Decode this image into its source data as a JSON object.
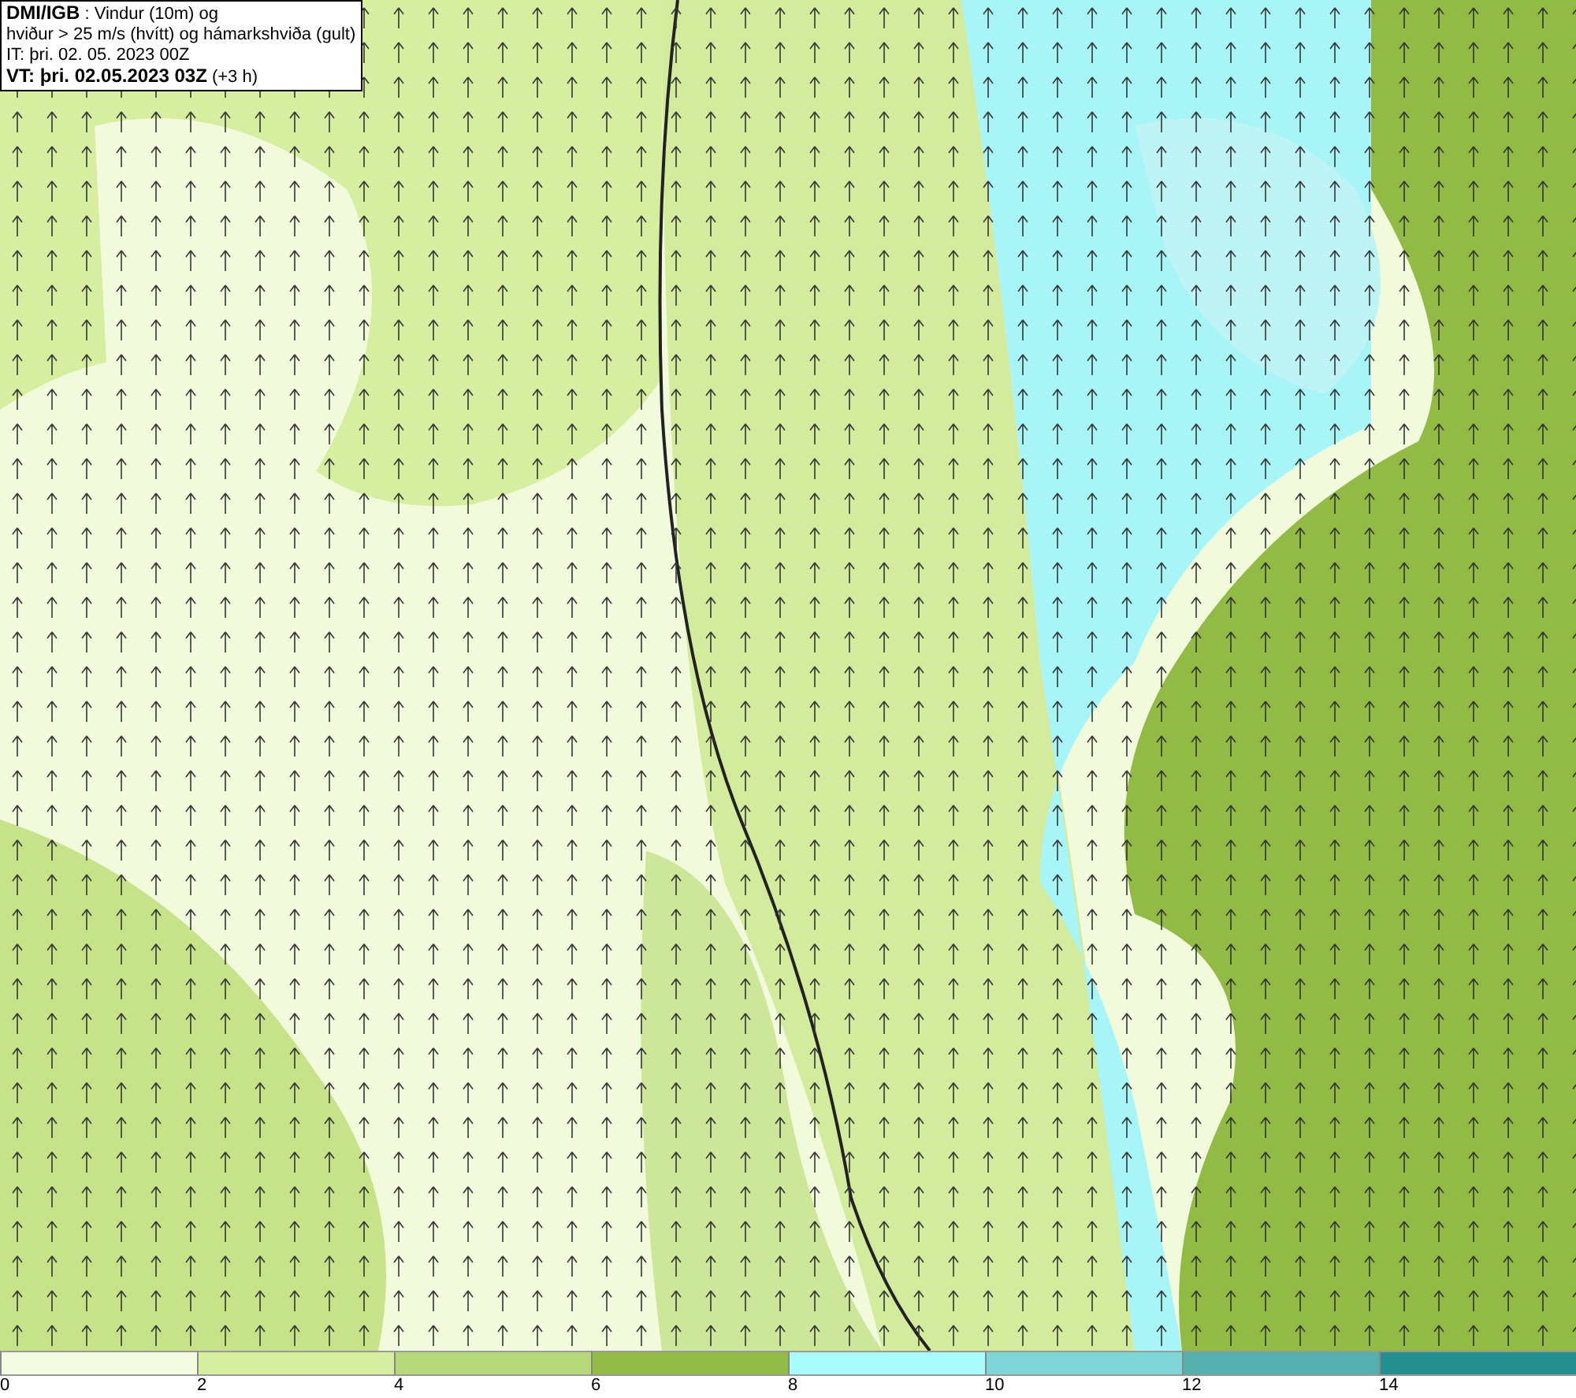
{
  "header": {
    "title": "**DMI/IGB** : Vindur (10m) og",
    "subtitle": "hviður > 25 m/s (hvítt) og hámarkshviða (gult)",
    "issue_time": "IT: þri. 02. 05. 2023 00Z",
    "valid_time": "**VT: þri. 02.05.2023 03Z** (+3 h)"
  },
  "legend": {
    "segments": [
      {
        "color": "#f4fbe0",
        "label": "0"
      },
      {
        "color": "#d6eea0",
        "label": "2"
      },
      {
        "color": "#b5d978",
        "label": "4"
      },
      {
        "color": "#92bb45",
        "label": "6"
      },
      {
        "color": "#a8fcfc",
        "label": "8"
      },
      {
        "color": "#7fd6d6",
        "label": "10"
      },
      {
        "color": "#55b0b0",
        "label": "12"
      },
      {
        "color": "#268f8f",
        "label": "14"
      }
    ]
  }
}
